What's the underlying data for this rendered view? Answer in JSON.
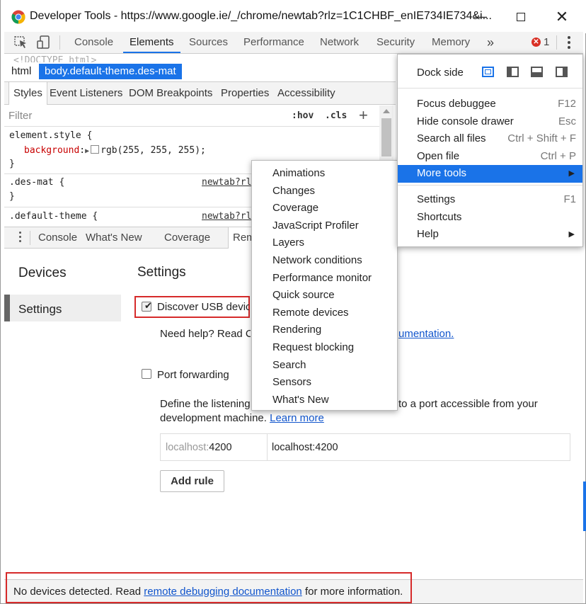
{
  "titlebar": {
    "title": "Developer Tools - https://www.google.ie/_/chrome/newtab?rlz=1C1CHBF_enIE734IE734&i..."
  },
  "main_toolbar": {
    "tabs": [
      "Console",
      "Elements",
      "Sources",
      "Performance",
      "Network",
      "Security",
      "Memory"
    ],
    "more": "»",
    "error_count": "1"
  },
  "breadcrumb": {
    "items": [
      "html",
      "body.default-theme.des-mat"
    ],
    "doctype_clip": "<!DOCTYPE html>"
  },
  "styles_tabs": [
    "Styles",
    "Event Listeners",
    "DOM Breakpoints",
    "Properties",
    "Accessibility"
  ],
  "filter": {
    "placeholder": "Filter",
    "hov": ":hov",
    "cls": ".cls",
    "add": "+"
  },
  "css_rules": {
    "element_style_selector": "element.style {",
    "background_prop": "background",
    "background_value": "rgb(255, 255, 255);",
    "close_brace": "}",
    "des_mat_selector": ".des-mat {",
    "des_mat_link": "newtab?rl",
    "default_theme_selector": ".default-theme {",
    "default_theme_link": "newtab?rl"
  },
  "drawer_tabs": [
    "Console",
    "What's New",
    "Coverage",
    "Rem"
  ],
  "remote": {
    "sidebar": [
      "Devices",
      "Settings"
    ],
    "heading": "Settings",
    "discover_usb": "Discover USB device",
    "need_help": "Need help? Read Ch",
    "doc_link_clip": "umentation.",
    "port_forwarding": "Port forwarding",
    "define_line1_a": "Define the listening",
    "define_line1_b": "to a port accessible from your",
    "define_line2": "development machine.",
    "learn_more": "Learn more",
    "rule_port_prefix": "localhost:",
    "rule_port": "4200",
    "rule_address": "localhost:4200",
    "add_rule": "Add rule"
  },
  "more_tools_menu": [
    "Animations",
    "Changes",
    "Coverage",
    "JavaScript Profiler",
    "Layers",
    "Network conditions",
    "Performance monitor",
    "Quick source",
    "Remote devices",
    "Rendering",
    "Request blocking",
    "Search",
    "Sensors",
    "What's New"
  ],
  "main_menu": {
    "dock_side": "Dock side",
    "items": [
      {
        "label": "Focus debuggee",
        "shortcut": "F12"
      },
      {
        "label": "Hide console drawer",
        "shortcut": "Esc"
      },
      {
        "label": "Search all files",
        "shortcut": "Ctrl + Shift + F"
      },
      {
        "label": "Open file",
        "shortcut": "Ctrl + P"
      },
      {
        "label": "More tools",
        "shortcut": "▶"
      }
    ],
    "items2": [
      {
        "label": "Settings",
        "shortcut": "F1"
      },
      {
        "label": "Shortcuts",
        "shortcut": ""
      },
      {
        "label": "Help",
        "shortcut": "▶"
      }
    ]
  },
  "status": {
    "text_before": "No devices detected. Read ",
    "link": "remote debugging documentation",
    "text_after": " for more information."
  },
  "colors": {
    "accent": "#1a73e8",
    "highlight_box": "#d62a2a",
    "error": "#d93025"
  }
}
